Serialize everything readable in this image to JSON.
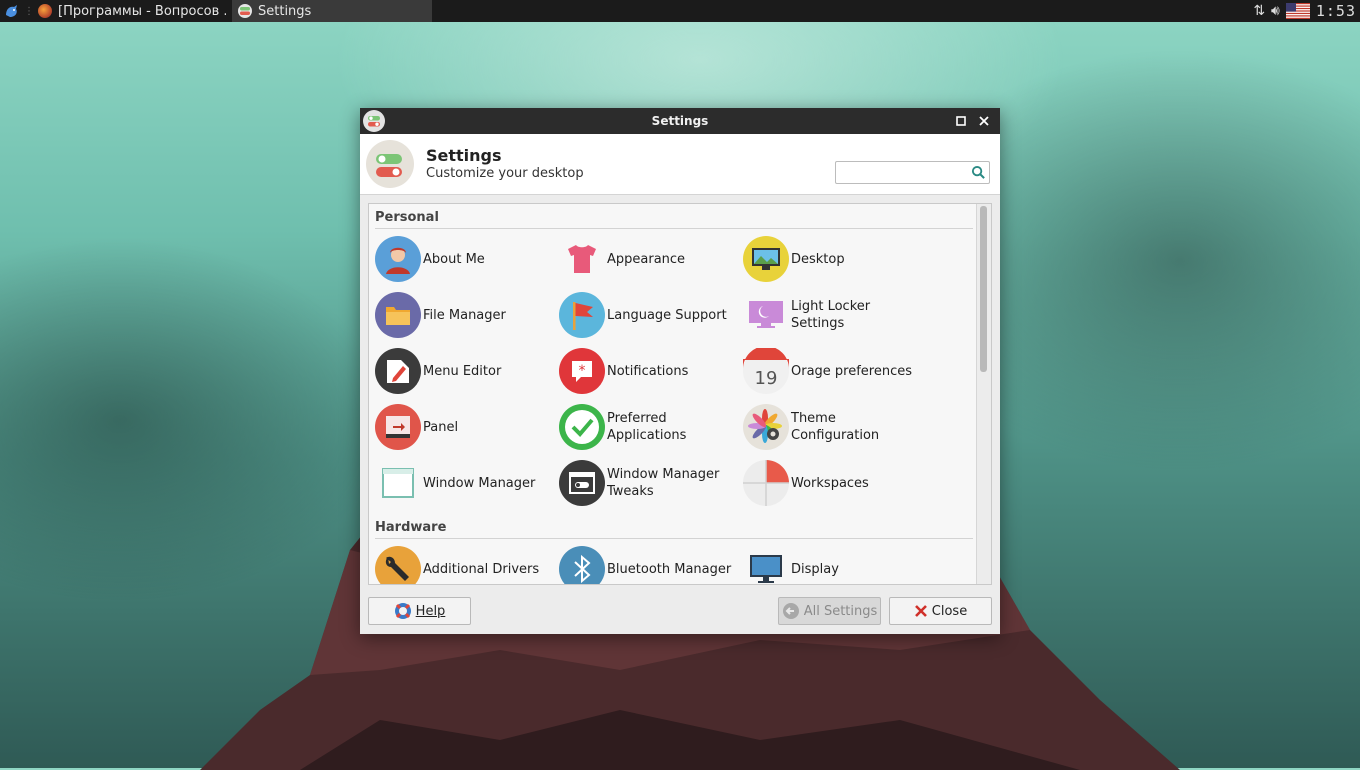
{
  "top_panel": {
    "tasks": [
      {
        "label": "[Программы - Вопросов ...",
        "icon": "firefox-icon"
      },
      {
        "label": "Settings",
        "icon": "settings-icon"
      }
    ],
    "clock": "1:53"
  },
  "window": {
    "title": "Settings",
    "header": {
      "title": "Settings",
      "subtitle": "Customize your desktop"
    },
    "search": {
      "placeholder": "",
      "value": ""
    },
    "sections": [
      {
        "title": "Personal",
        "items": [
          {
            "label": "About Me",
            "icon": "about-me-icon"
          },
          {
            "label": "Appearance",
            "icon": "appearance-icon"
          },
          {
            "label": "Desktop",
            "icon": "desktop-icon"
          },
          {
            "label": "File Manager",
            "icon": "file-manager-icon"
          },
          {
            "label": "Language Support",
            "icon": "language-support-icon"
          },
          {
            "label": "Light Locker Settings",
            "icon": "light-locker-icon"
          },
          {
            "label": "Menu Editor",
            "icon": "menu-editor-icon"
          },
          {
            "label": "Notifications",
            "icon": "notifications-icon"
          },
          {
            "label": "Orage preferences",
            "icon": "orage-calendar-icon"
          },
          {
            "label": "Panel",
            "icon": "panel-icon"
          },
          {
            "label": "Preferred Applications",
            "icon": "preferred-applications-icon"
          },
          {
            "label": "Theme Configuration",
            "icon": "theme-configuration-icon"
          },
          {
            "label": "Window Manager",
            "icon": "window-manager-icon"
          },
          {
            "label": "Window Manager Tweaks",
            "icon": "window-manager-tweaks-icon"
          },
          {
            "label": "Workspaces",
            "icon": "workspaces-icon"
          }
        ]
      },
      {
        "title": "Hardware",
        "items": [
          {
            "label": "Additional Drivers",
            "icon": "additional-drivers-icon"
          },
          {
            "label": "Bluetooth Manager",
            "icon": "bluetooth-icon"
          },
          {
            "label": "Display",
            "icon": "display-icon"
          }
        ]
      }
    ],
    "calendar_day": "19",
    "buttons": {
      "help": "Help",
      "all_settings": "All Settings",
      "close": "Close"
    }
  }
}
